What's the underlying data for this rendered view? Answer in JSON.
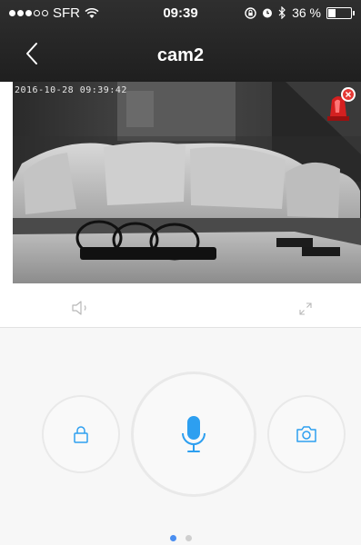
{
  "status_bar": {
    "carrier": "SFR",
    "time": "09:39",
    "battery": "36 %",
    "battery_level": 0.36,
    "signal_bars_filled": 3,
    "signal_bars_total": 5
  },
  "nav": {
    "title": "cam2",
    "back_icon": "chevron-left-icon"
  },
  "video": {
    "timestamp": "2016-10-28  09:39:42",
    "alarm_icon": "siren-icon"
  },
  "controls": {
    "speaker_icon": "speaker-icon",
    "fullscreen_icon": "expand-icon"
  },
  "actions": {
    "lock_icon": "lock-icon",
    "mic_icon": "microphone-icon",
    "camera_icon": "camera-icon"
  },
  "pager": {
    "pages": 2,
    "active": 0
  },
  "colors": {
    "accent": "#2d9ff0",
    "header": "#262626",
    "alarm_red": "#e53935"
  }
}
